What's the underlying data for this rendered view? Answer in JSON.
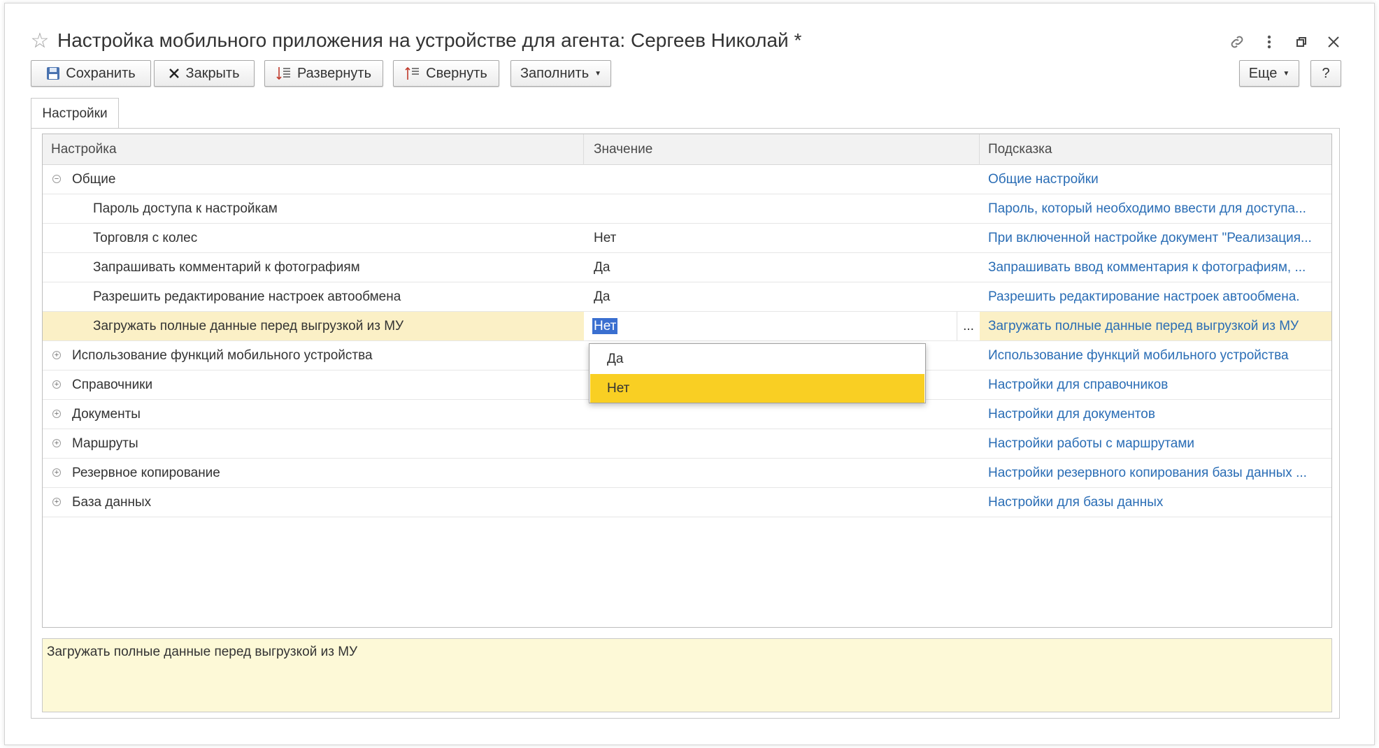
{
  "window": {
    "title": "Настройка мобильного приложения на устройстве для агента: Сергеев Николай *",
    "controls": [
      "link-icon",
      "more-icon",
      "restore-icon",
      "close-icon"
    ]
  },
  "toolbar": {
    "save_label": "Сохранить",
    "close_label": "Закрыть",
    "expand_label": "Развернуть",
    "collapse_label": "Свернуть",
    "fill_label": "Заполнить",
    "more_label": "Еще",
    "help_label": "?"
  },
  "tabs": [
    {
      "label": "Настройки"
    }
  ],
  "grid": {
    "columns": [
      "Настройка",
      "Значение",
      "Подсказка"
    ],
    "rows": [
      {
        "name": "Общие",
        "value": "",
        "hint": "Общие настройки",
        "group": true,
        "expanded": true
      },
      {
        "name": "Пароль доступа к настройкам",
        "value": "",
        "hint": "Пароль, который необходимо ввести для доступа..."
      },
      {
        "name": "Торговля с колес",
        "value": "Нет",
        "hint": "При включенной настройке документ \"Реализация..."
      },
      {
        "name": "Запрашивать комментарий к фотографиям",
        "value": "Да",
        "hint": "Запрашивать ввод комментария к фотографиям, ..."
      },
      {
        "name": "Разрешить редактирование настроек автообмена",
        "value": "Да",
        "hint": "Разрешить редактирование настроек автообмена."
      },
      {
        "name": "Загружать полные данные перед выгрузкой из МУ",
        "value": "Нет",
        "hint": "Загружать полные данные перед выгрузкой из МУ",
        "selected": true
      },
      {
        "name": "Использование функций мобильного устройства",
        "value": "",
        "hint": "Использование функций мобильного устройства",
        "group": true
      },
      {
        "name": "Справочники",
        "value": "",
        "hint": "Настройки для справочников",
        "group": true
      },
      {
        "name": "Документы",
        "value": "",
        "hint": "Настройки для документов",
        "group": true
      },
      {
        "name": "Маршруты",
        "value": "",
        "hint": "Настройки работы с маршрутами",
        "group": true
      },
      {
        "name": "Резервное копирование",
        "value": "",
        "hint": "Настройки резервного копирования базы данных ...",
        "group": true
      },
      {
        "name": "База данных",
        "value": "",
        "hint": "Настройки для базы данных",
        "group": true
      }
    ],
    "edit_button_label": "..."
  },
  "dropdown": {
    "options": [
      "Да",
      "Нет"
    ],
    "selected": "Нет"
  },
  "hint_panel": {
    "text": "Загружать полные данные перед выгрузкой из МУ"
  },
  "colors": {
    "selected_row": "#fbf0c6",
    "hint_link": "#2a6db5",
    "dropdown_active": "#f9cf23",
    "hint_background": "#fdf9d7",
    "selection": "#3a6fd0"
  }
}
